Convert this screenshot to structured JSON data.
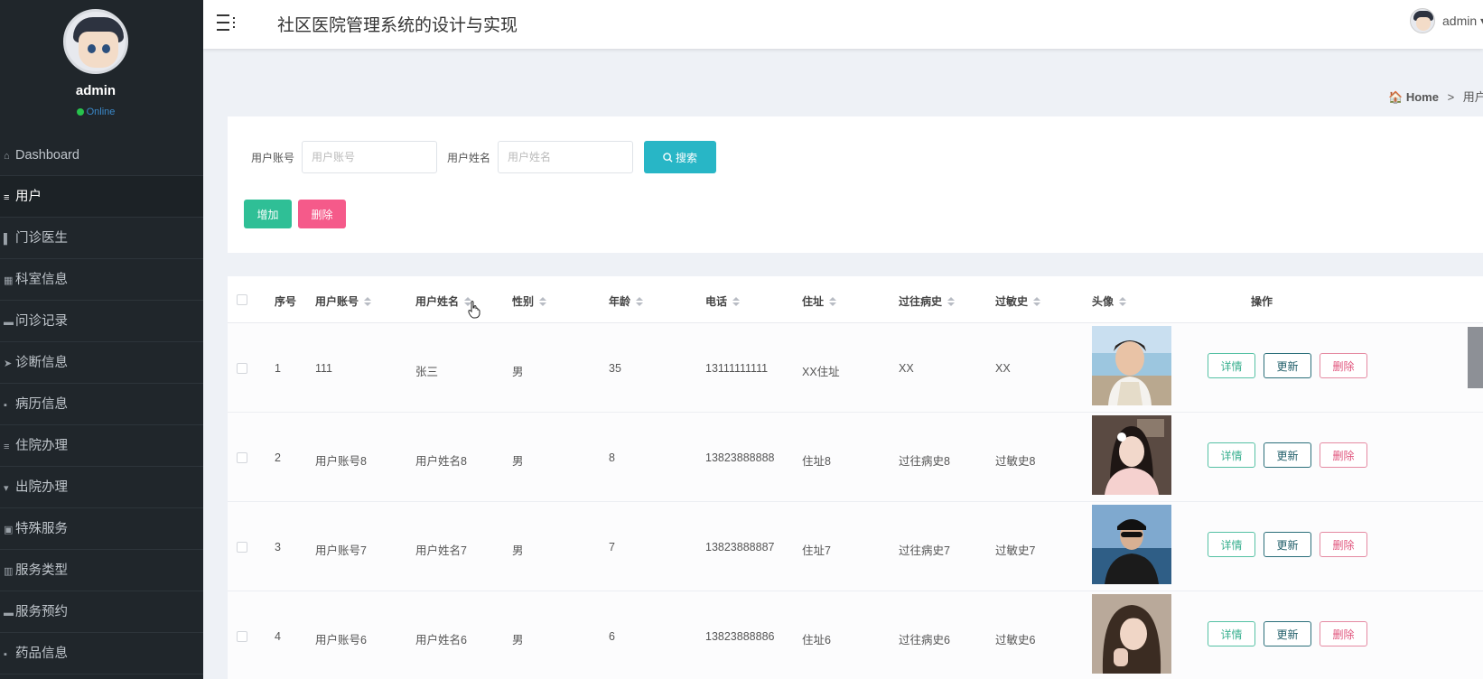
{
  "app": {
    "title": "社区医院管理系统的设计与实现",
    "user": "admin",
    "user_arrow": "▾"
  },
  "sidebar": {
    "name": "admin",
    "status": "Online",
    "items": [
      {
        "label": "Dashboard",
        "icon": "home-icon",
        "glyph": "⌂"
      },
      {
        "label": "用户",
        "icon": "sliders-icon",
        "glyph": "≡"
      },
      {
        "label": "门诊医生",
        "icon": "book-icon",
        "glyph": "▌"
      },
      {
        "label": "科室信息",
        "icon": "grid-icon",
        "glyph": "▦"
      },
      {
        "label": "问诊记录",
        "icon": "thumbs-up-icon",
        "glyph": "▬"
      },
      {
        "label": "诊断信息",
        "icon": "paper-plane-icon",
        "glyph": "➤"
      },
      {
        "label": "病历信息",
        "icon": "apps-icon",
        "glyph": "▪"
      },
      {
        "label": "住院办理",
        "icon": "list-icon",
        "glyph": "≡"
      },
      {
        "label": "出院办理",
        "icon": "trophy-icon",
        "glyph": "▾"
      },
      {
        "label": "特殊服务",
        "icon": "clipboard-icon",
        "glyph": "▣"
      },
      {
        "label": "服务类型",
        "icon": "bar-chart-icon",
        "glyph": "▥"
      },
      {
        "label": "服务预约",
        "icon": "comment-icon",
        "glyph": "▬"
      },
      {
        "label": "药品信息",
        "icon": "apps-icon",
        "glyph": "▪"
      }
    ]
  },
  "breadcrumb": {
    "home": "Home",
    "separator": ">",
    "current": "用户"
  },
  "search": {
    "account_label": "用户账号",
    "account_placeholder": "用户账号",
    "name_label": "用户姓名",
    "name_placeholder": "用户姓名",
    "search_button": "搜索"
  },
  "actions": {
    "add": "增加",
    "delete": "删除"
  },
  "table": {
    "headers": [
      "序号",
      "用户账号",
      "用户姓名",
      "性别",
      "年龄",
      "电话",
      "住址",
      "过往病史",
      "过敏史",
      "头像",
      "操作"
    ],
    "ops": {
      "detail": "详情",
      "update": "更新",
      "delete": "删除"
    },
    "rows": [
      {
        "index": "1",
        "account": "111",
        "name": "张三",
        "gender": "男",
        "age": "35",
        "phone": "13111111111",
        "address": "XX住址",
        "history": "XX",
        "allergy": "XX",
        "avatar": "young man in white tank top outdoors"
      },
      {
        "index": "2",
        "account": "用户账号8",
        "name": "用户姓名8",
        "gender": "男",
        "age": "8",
        "phone": "13823888888",
        "address": "住址8",
        "history": "过往病史8",
        "allergy": "过敏史8",
        "avatar": "girl with flower in hair, pink dress"
      },
      {
        "index": "3",
        "account": "用户账号7",
        "name": "用户姓名7",
        "gender": "男",
        "age": "7",
        "phone": "13823888887",
        "address": "住址7",
        "history": "过往病史7",
        "allergy": "过敏史7",
        "avatar": "young man with cap and sunglasses by the sea"
      },
      {
        "index": "4",
        "account": "用户账号6",
        "name": "用户姓名6",
        "gender": "男",
        "age": "6",
        "phone": "13823888886",
        "address": "住址6",
        "history": "过往病史6",
        "allergy": "过敏史6",
        "avatar": "long-haired girl selfie"
      }
    ]
  },
  "colors": {
    "sidebar_bg": "#20262b",
    "search_button": "#28b6c6",
    "add_button": "#2fbf96",
    "delete_button": "#f55a8a",
    "online_dot": "#27c24c"
  }
}
